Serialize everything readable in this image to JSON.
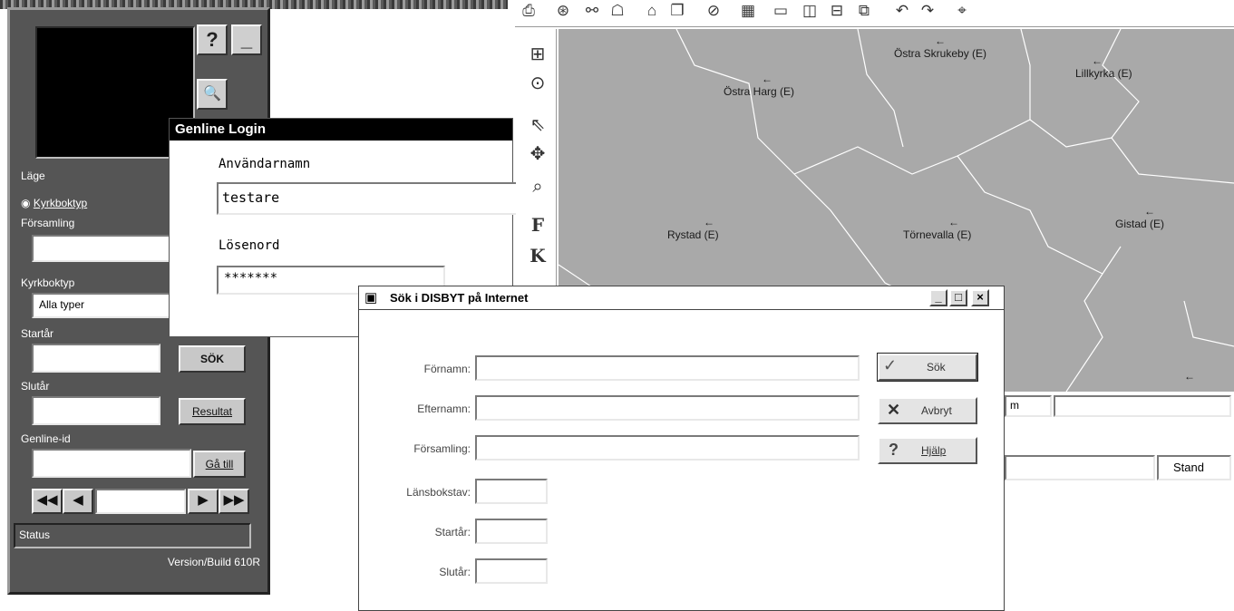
{
  "left_panel": {
    "help_button": "?",
    "minimize_button": "_",
    "mode_label": "Läge",
    "radio_kyrkboktyp": "Kyrkboktyp",
    "forsamling_label": "Församling",
    "forsamling_value": "",
    "kyrkboktyp_label": "Kyrkboktyp",
    "kyrkboktyp_value": "Alla typer",
    "startar_label": "Startår",
    "startar_value": "",
    "sok_button": "SÖK",
    "slutar_label": "Slutår",
    "slutar_value": "",
    "resultat_button": "Resultat",
    "genline_id_label": "Genline-id",
    "genline_id_value": "",
    "ga_till_button": "Gå till",
    "status_text": "Status",
    "version_text": "Version/Build 610R"
  },
  "login": {
    "title": "Genline Login",
    "username_label": "Användarnamn",
    "username_value": "testare",
    "password_label": "Lösenord",
    "password_value": "*******"
  },
  "map": {
    "places": [
      "Östra Skrukeby (E)",
      "Lillkyrka (E)",
      "Östra Harg (E)",
      "Rystad (E)",
      "Törnevalla (E)",
      "Gistad (E)"
    ],
    "status_field_1": "m",
    "status_field_2": "",
    "status_right": "Stand"
  },
  "disbyt": {
    "title": "Sök i DISBYT på Internet",
    "fields": [
      {
        "label": "Förnamn:",
        "value": ""
      },
      {
        "label": "Efternamn:",
        "value": ""
      },
      {
        "label": "Församling:",
        "value": ""
      },
      {
        "label": "Länsbokstav:",
        "value": ""
      },
      {
        "label": "Startår:",
        "value": ""
      },
      {
        "label": "Slutår:",
        "value": ""
      }
    ],
    "buttons": {
      "sok": "Sök",
      "avbryt": "Avbryt",
      "hjalp": "Hjälp"
    }
  }
}
